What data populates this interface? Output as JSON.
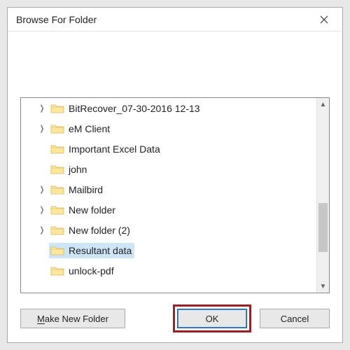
{
  "window": {
    "title": "Browse For Folder"
  },
  "tree": {
    "items": [
      {
        "label": "BitRecover_07-30-2016 12-13",
        "expander": true
      },
      {
        "label": "eM Client",
        "expander": true
      },
      {
        "label": "Important Excel Data",
        "expander": false
      },
      {
        "label": "john",
        "expander": false
      },
      {
        "label": "Mailbird",
        "expander": true
      },
      {
        "label": "New folder",
        "expander": true
      },
      {
        "label": "New folder (2)",
        "expander": true
      },
      {
        "label": "Resultant data",
        "expander": false,
        "selected": true
      },
      {
        "label": "unlock-pdf",
        "expander": false
      }
    ]
  },
  "buttons": {
    "make_new_folder": "Make New Folder",
    "ok": "OK",
    "cancel": "Cancel"
  }
}
